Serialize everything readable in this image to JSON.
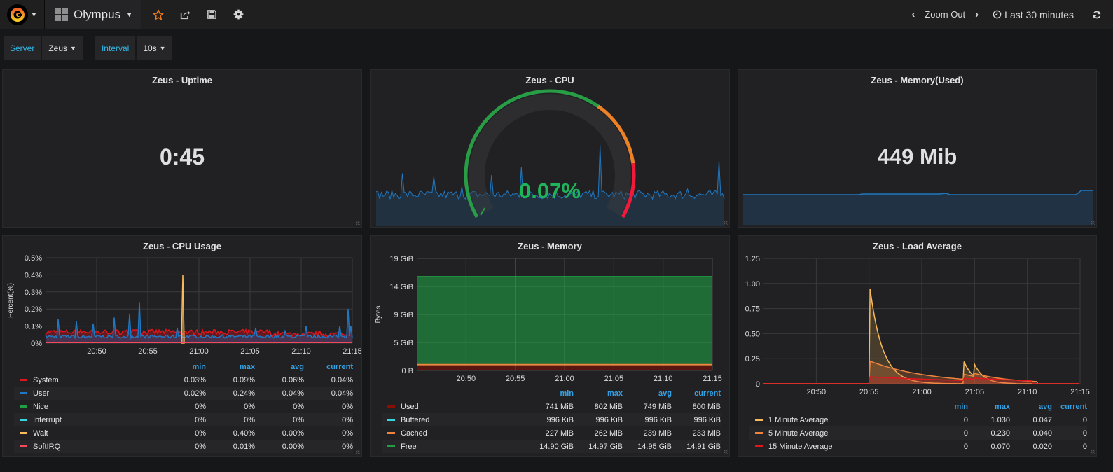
{
  "navbar": {
    "dashboard_title": "Olympus",
    "zoom_out": "Zoom Out",
    "time_range": "Last 30 minutes",
    "icons": [
      "grafana-logo-icon",
      "dashboard-grid-icon",
      "star-icon",
      "share-icon",
      "save-icon",
      "gear-icon",
      "chevron-left-icon",
      "chevron-right-icon",
      "clock-icon",
      "refresh-icon"
    ]
  },
  "variables": {
    "server_label": "Server",
    "server_value": "Zeus",
    "interval_label": "Interval",
    "interval_value": "10s"
  },
  "panels": {
    "uptime": {
      "title": "Zeus - Uptime",
      "value": "0:45"
    },
    "cpu_gauge": {
      "title": "Zeus - CPU",
      "value": "0.07%",
      "value_color": "#1fb35a",
      "thresholds": [
        "#299c46",
        "#ed8128",
        "#f2193b"
      ],
      "gauge_fraction": 0.0007
    },
    "memory_used": {
      "title": "Zeus - Memory(Used)",
      "value": "449 Mib"
    },
    "cpu_usage": {
      "title": "Zeus - CPU Usage"
    },
    "memory": {
      "title": "Zeus - Memory"
    },
    "load_average": {
      "title": "Zeus - Load Average"
    }
  },
  "legend_headers": [
    "min",
    "max",
    "avg",
    "current"
  ],
  "chart_data": [
    {
      "id": "cpu_usage",
      "type": "area",
      "title": "Zeus - CPU Usage",
      "ylabel": "Percent(%)",
      "ylim": [
        0,
        0.5
      ],
      "yticks": [
        "0%",
        "0.1%",
        "0.2%",
        "0.3%",
        "0.4%",
        "0.5%"
      ],
      "xticks": [
        "20:50",
        "20:55",
        "21:00",
        "21:05",
        "21:10",
        "21:15"
      ],
      "grid": true,
      "series": [
        {
          "name": "System",
          "color": "#e0161e",
          "min": "0.03%",
          "max": "0.09%",
          "avg": "0.06%",
          "current": "0.04%"
        },
        {
          "name": "User",
          "color": "#1f78c1",
          "min": "0.02%",
          "max": "0.24%",
          "avg": "0.04%",
          "current": "0.04%"
        },
        {
          "name": "Nice",
          "color": "#1f9e44",
          "min": "0%",
          "max": "0%",
          "avg": "0%",
          "current": "0%"
        },
        {
          "name": "Interrupt",
          "color": "#37d4e3",
          "min": "0%",
          "max": "0%",
          "avg": "0%",
          "current": "0%"
        },
        {
          "name": "Wait",
          "color": "#f9ba5a",
          "min": "0%",
          "max": "0.40%",
          "avg": "0.00%",
          "current": "0%"
        },
        {
          "name": "SoftIRQ",
          "color": "#f2495c",
          "min": "0%",
          "max": "0.01%",
          "avg": "0.00%",
          "current": "0%"
        }
      ]
    },
    {
      "id": "memory",
      "type": "area",
      "title": "Zeus - Memory",
      "ylabel": "Bytes",
      "ylim": [
        0,
        19
      ],
      "yticks": [
        "0 B",
        "5 GiB",
        "9 GiB",
        "14 GiB",
        "19 GiB"
      ],
      "xticks": [
        "20:50",
        "20:55",
        "21:00",
        "21:05",
        "21:10",
        "21:15"
      ],
      "grid": true,
      "series": [
        {
          "name": "Used",
          "color": "#890f02",
          "min": "741 MiB",
          "max": "802 MiB",
          "avg": "749 MiB",
          "current": "800 MiB"
        },
        {
          "name": "Buffered",
          "color": "#37d4e3",
          "min": "996 KiB",
          "max": "996 KiB",
          "avg": "996 KiB",
          "current": "996 KiB"
        },
        {
          "name": "Cached",
          "color": "#ef843c",
          "min": "227 MiB",
          "max": "262 MiB",
          "avg": "239 MiB",
          "current": "233 MiB"
        },
        {
          "name": "Free",
          "color": "#1f9e44",
          "min": "14.90 GiB",
          "max": "14.97 GiB",
          "avg": "14.95 GiB",
          "current": "14.91 GiB"
        }
      ]
    },
    {
      "id": "load_average",
      "type": "line",
      "title": "Zeus - Load Average",
      "ylabel": "",
      "ylim": [
        0,
        1.25
      ],
      "yticks": [
        "0",
        "0.25",
        "0.50",
        "0.75",
        "1.00",
        "1.25"
      ],
      "xticks": [
        "20:50",
        "20:55",
        "21:00",
        "21:05",
        "21:10",
        "21:15"
      ],
      "grid": true,
      "series": [
        {
          "name": "1 Minute Average",
          "color": "#f9ba5a",
          "min": "0",
          "max": "1.030",
          "avg": "0.047",
          "current": "0"
        },
        {
          "name": "5 Minute Average",
          "color": "#ef843c",
          "min": "0",
          "max": "0.230",
          "avg": "0.040",
          "current": "0"
        },
        {
          "name": "15 Minute Average",
          "color": "#e0161e",
          "min": "0",
          "max": "0.070",
          "avg": "0.020",
          "current": "0"
        }
      ]
    }
  ]
}
